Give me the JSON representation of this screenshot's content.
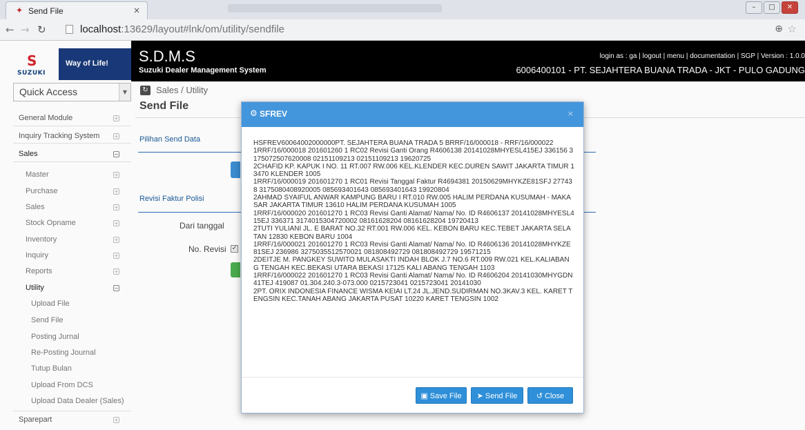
{
  "browser": {
    "tab_title": "Send File",
    "tab_close": "×",
    "url_host": "localhost",
    "url_path": ":13629/layout#lnk/om/utility/sendfile"
  },
  "brand": {
    "logo_text": "SUZUKI",
    "tagline": "Way of Life!"
  },
  "header": {
    "app_title": "S.D.M.S",
    "app_subtitle": "Suzuki Dealer Management System",
    "top_links": "login as : ga | logout | menu | documentation  |  SGP  |  Version : 1.0.0",
    "dealer": "6006400101 - PT. SEJAHTERA BUANA TRADA - JKT - PULO GADUNG"
  },
  "sidebar": {
    "quick_access": "Quick Access",
    "items": [
      {
        "label": "General Module"
      },
      {
        "label": "Inquiry Tracking System"
      },
      {
        "label": "Sales"
      },
      {
        "label": "Master"
      },
      {
        "label": "Purchase"
      },
      {
        "label": "Sales"
      },
      {
        "label": "Stock Opname"
      },
      {
        "label": "Inventory"
      },
      {
        "label": "Inquiry"
      },
      {
        "label": "Reports"
      },
      {
        "label": "Utility"
      },
      {
        "label": "Upload File"
      },
      {
        "label": "Send File"
      },
      {
        "label": "Posting Jurnal"
      },
      {
        "label": "Re-Posting Journal"
      },
      {
        "label": "Tutup Bulan"
      },
      {
        "label": "Upload From DCS"
      },
      {
        "label": "Upload Data Dealer (Sales)"
      },
      {
        "label": "Sparepart"
      }
    ]
  },
  "main": {
    "breadcrumb": "Sales / Utility",
    "page_title": "Send File",
    "section1": "Pilihan Send Data",
    "section2": "Revisi Faktur Polisi",
    "dari_tanggal": "Dari tanggal",
    "no_revisi": "No. Revisi"
  },
  "modal": {
    "title": "SFREV",
    "close": "×",
    "content": "HSFREV60064002000000PT. SEJAHTERA BUANA TRADA 5 BRRF/16/000018 - RRF/16/000022\n1RRF/16/000018 201601260 1 RC02 Revisi Ganti Orang R4606138 20141028MHYESL415EJ 336156 3175072507620008 02151109213 02151109213 19620725\n2CHAFID KP. KAPUK I NO. 11 RT.007 RW.006 KEL.KLENDER KEC.DUREN SAWIT JAKARTA TIMUR 13470 KLENDER 1005\n1RRF/16/000019 201601270 1 RC01 Revisi Tanggal Faktur R4694381 20150629MHYKZE81SFJ 277438 3175080408920005 085693401643 085693401643 19920804\n2AHMAD SYAIFUL ANWAR KAMPUNG BARU I RT.010 RW.005 HALIM PERDANA KUSUMAH - MAKASAR JAKARTA TIMUR 13610 HALIM PERDANA KUSUMAH 1005\n1RRF/16/000020 201601270 1 RC03 Revisi Ganti Alamat/ Nama/ No. ID R4606137 20141028MHYESL415EJ 336371 3174015304720002 08161628204 08161628204 19720413\n2TUTI YULIANI JL. E BARAT NO.32 RT.001 RW.006 KEL. KEBON BARU KEC.TEBET JAKARTA SELATAN 12830 KEBON BARU 1004\n1RRF/16/000021 201601270 1 RC03 Revisi Ganti Alamat/ Nama/ No. ID R4606136 20141028MHYKZE81SEJ 236986 3275035512570021 081808492729 081808492729 19571215\n2DEITJE M. PANGKEY SUWITO MULASAKTI INDAH BLOK J.7 NO.6 RT.009 RW.021 KEL.KALIABANG TENGAH KEC.BEKASI UTARA BEKASI 17125 KALI ABANG TENGAH 1103\n1RRF/16/000022 201601270 1 RC03 Revisi Ganti Alamat/ Nama/ No. ID R4606204 20141030MHYGDN41TEJ 419087 01.304.240.3-073.000 0215723041 0215723041 20141030\n2PT. ORIX INDONESIA FINANCE WISMA KEIAI LT.24 JL.JEND.SUDIRMAN NO.3KAV.3 KEL. KARET TENGSIN KEC.TANAH ABANG JAKARTA PUSAT 10220 KARET TENGSIN 1002",
    "buttons": {
      "save": "Save File",
      "send": "Send File",
      "close": "Close"
    }
  },
  "colors": {
    "modal_header": "#4496dc",
    "button_blue": "#2f8fd8",
    "brand_blue": "#1a3a7a",
    "suzuki_red": "#d7262e"
  }
}
